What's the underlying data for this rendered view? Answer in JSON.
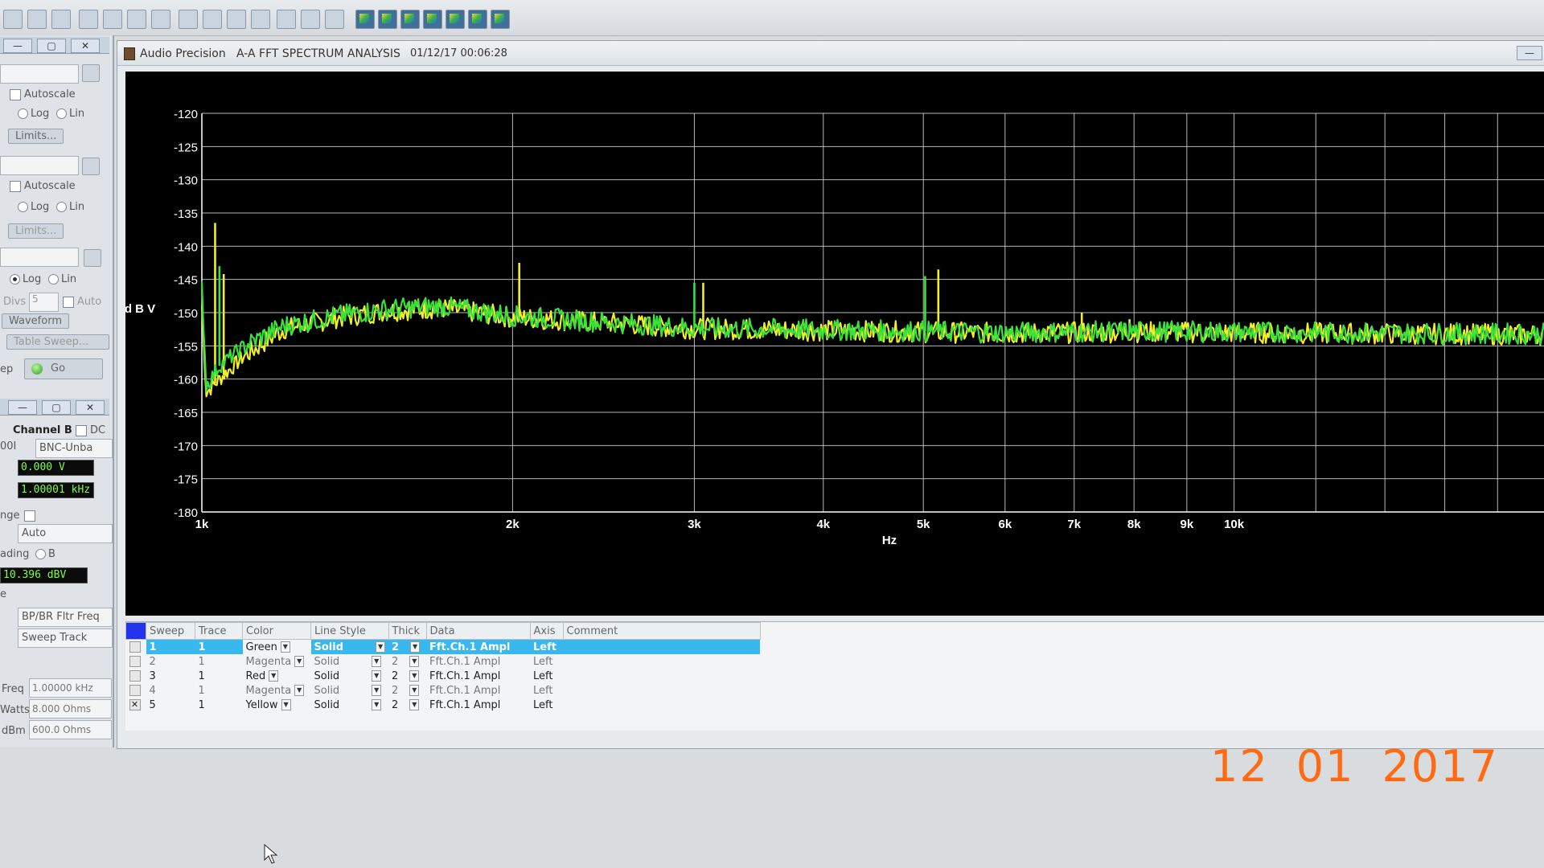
{
  "toolbar": {
    "icons": [
      "sweep-icon",
      "generator-icon",
      "analyzer-icon",
      "graph-icon",
      "bargraph-icon",
      "data-editor-icon",
      "report-icon",
      "trace-color-icon"
    ]
  },
  "left_panel": {
    "win1": {
      "min": "—",
      "max": "▢",
      "close": "✕"
    },
    "autoscale_1": "Autoscale",
    "log_1": "Log",
    "lin_1": "Lin",
    "limits_1": "Limits...",
    "autoscale_2": "Autoscale",
    "log_2": "Log",
    "lin_2": "Lin",
    "limits_2": "Limits...",
    "log_3": "Log",
    "lin_3": "Lin",
    "divs_label": "Divs",
    "divs_value": "5",
    "auto_label": "Auto",
    "waveform_btn": "Waveform",
    "table_sweep_btn": "Table Sweep...",
    "ep_label": "ep",
    "go_label": "Go",
    "win2": {
      "min": "—",
      "max": "▢",
      "close": "✕"
    },
    "channel_b": "Channel B",
    "dc_label": "DC",
    "range_code": "00I",
    "connector": "BNC-Unba",
    "volt_reading": "0.000   V",
    "freq_reading": "1.00001 kHz",
    "range_label": "nge",
    "auto_select": "Auto",
    "reading_label": "ading",
    "b_label": "B",
    "level_reading": "10.396 dBV",
    "e_label": "e",
    "bp_filter": "BP/BR Fltr Freq",
    "sweep_track": "Sweep Track",
    "freq_label": "Freq",
    "freq_value": "1.00000 kHz",
    "watts_label": "Watts",
    "watts_value": "8.000   Ohms",
    "dbm_label": "dBm",
    "dbm_value": "600.0   Ohms"
  },
  "graph_window": {
    "app_name": "Audio Precision",
    "title": "A-A FFT SPECTRUM ANALYSIS",
    "timestamp": "01/12/17 00:06:28",
    "min": "—"
  },
  "chart_data": {
    "type": "line",
    "xlabel": "Hz",
    "ylabel": "d B V",
    "x_scale": "log",
    "xlim": [
      1000,
      20000
    ],
    "ylim": [
      -180,
      -120
    ],
    "x_ticks": [
      "1k",
      "2k",
      "3k",
      "4k",
      "5k",
      "6k",
      "7k",
      "8k",
      "9k",
      "10k"
    ],
    "x_tick_values": [
      1000,
      2000,
      3000,
      4000,
      5000,
      6000,
      7000,
      8000,
      9000,
      10000
    ],
    "y_ticks": [
      "-120",
      "-125",
      "-130",
      "-135",
      "-140",
      "-145",
      "-150",
      "-155",
      "-160",
      "-165",
      "-170",
      "-175",
      "-180"
    ],
    "grid": true,
    "colors": {
      "green": "#38e23a",
      "yellow": "#f2ee2a",
      "grid": "#d8d8d8",
      "axis_text": "#ffffff",
      "background": "#000000"
    },
    "series": [
      {
        "name": "Green",
        "x": [
          1000,
          1010,
          1040,
          1100,
          1200,
          1350,
          1500,
          1700,
          2000,
          2500,
          3000,
          4000,
          5000,
          6000,
          7000,
          8000,
          10000,
          12000,
          15000,
          20000
        ],
        "y": [
          -146,
          -161,
          -158,
          -155,
          -152,
          -150.5,
          -149.5,
          -149,
          -150.5,
          -151.5,
          -152.3,
          -152.6,
          -152.8,
          -153,
          -152.9,
          -152.8,
          -152.9,
          -153,
          -153.1,
          -153.2
        ],
        "spikes": [
          [
            1040,
            -143
          ],
          [
            3000,
            -145.5
          ],
          [
            5020,
            -144.5
          ]
        ]
      },
      {
        "name": "Yellow",
        "x": [
          1000,
          1010,
          1040,
          1100,
          1200,
          1350,
          1500,
          1700,
          2000,
          2500,
          3000,
          4000,
          5000,
          6000,
          7000,
          8000,
          10000,
          12000,
          15000,
          20000
        ],
        "y": [
          -149,
          -162,
          -160,
          -156.5,
          -152.5,
          -150.8,
          -149.8,
          -149.3,
          -150.7,
          -151.6,
          -152.4,
          -152.7,
          -152.9,
          -153.1,
          -153,
          -152.9,
          -153,
          -153.1,
          -153.2,
          -153.3
        ],
        "spikes": [
          [
            1030,
            -136.5
          ],
          [
            1050,
            -144.2
          ],
          [
            2030,
            -142.5
          ],
          [
            3060,
            -145.5
          ],
          [
            5170,
            -143.5
          ],
          [
            7120,
            -150
          ],
          [
            7920,
            -151
          ]
        ]
      }
    ]
  },
  "legend": {
    "headers": [
      "Sweep",
      "Trace",
      "Color",
      "Line Style",
      "Thick",
      "Data",
      "Axis",
      "Comment"
    ],
    "rows": [
      {
        "sweep": "1",
        "trace": "1",
        "color": "Green",
        "style": "Solid",
        "thick": "2",
        "data": "Fft.Ch.1 Ampl",
        "axis": "Left",
        "comment": "",
        "checked": ""
      },
      {
        "sweep": "2",
        "trace": "1",
        "color": "Magenta",
        "style": "Solid",
        "thick": "2",
        "data": "Fft.Ch.1 Ampl",
        "axis": "Left",
        "comment": "",
        "checked": ""
      },
      {
        "sweep": "3",
        "trace": "1",
        "color": "Red",
        "style": "Solid",
        "thick": "2",
        "data": "Fft.Ch.1 Ampl",
        "axis": "Left",
        "comment": "",
        "checked": ""
      },
      {
        "sweep": "4",
        "trace": "1",
        "color": "Magenta",
        "style": "Solid",
        "thick": "2",
        "data": "Fft.Ch.1 Ampl",
        "axis": "Left",
        "comment": "",
        "checked": ""
      },
      {
        "sweep": "5",
        "trace": "1",
        "color": "Yellow",
        "style": "Solid",
        "thick": "2",
        "data": "Fft.Ch.1 Ampl",
        "axis": "Left",
        "comment": "",
        "checked": "✕"
      }
    ]
  },
  "date_stamp": {
    "day": "12",
    "month": "01",
    "year": "2017"
  }
}
